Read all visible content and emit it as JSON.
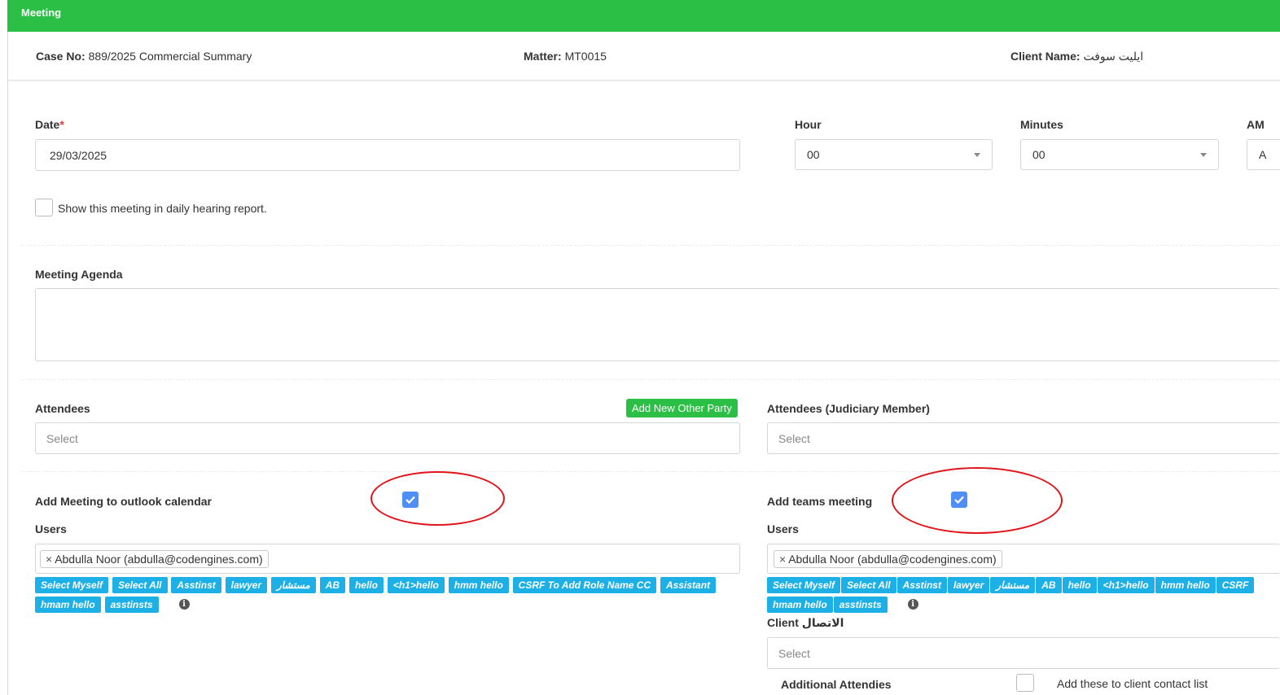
{
  "header": {
    "title": "Meeting"
  },
  "info": {
    "case_label": "Case No:",
    "case_value": "889/2025 Commercial Summary",
    "matter_label": "Matter:",
    "matter_value": "MT0015",
    "client_label": "Client Name:",
    "client_value": "ايليت سوفت"
  },
  "form": {
    "date_label": "Date",
    "date_required": "*",
    "date_value": "29/03/2025",
    "hour_label": "Hour",
    "hour_value": "00",
    "minutes_label": "Minutes",
    "minutes_value": "00",
    "ampm_label": "AM",
    "ampm_value": "A",
    "show_daily_label": "Show this meeting in daily hearing report.",
    "agenda_label": "Meeting Agenda",
    "attendees_label": "Attendees",
    "add_party_label": "Add New Other Party",
    "attendees_placeholder": "Select",
    "judiciary_label": "Attendees (Judiciary Member)",
    "judiciary_placeholder": "Select",
    "outlook_label": "Add Meeting to outlook calendar",
    "teams_label": "Add teams meeting",
    "users_label_left": "Users",
    "users_label_right": "Users",
    "user_chip_left": "Abdulla Noor (abdulla@codengines.com)",
    "user_chip_right": "Abdulla Noor (abdulla@codengines.com)",
    "client_contact_label": "Client الاتصال",
    "client_contact_placeholder": "Select",
    "additional_label": "Additional Attendies",
    "add_contact_label": "Add these to client contact list"
  },
  "tags_left": [
    "Select Myself",
    "Select All",
    "Asstinst",
    "lawyer",
    "مستشار",
    "AB",
    "hello",
    "<h1>hello",
    "hmm hello",
    "CSRF To Add Role Name CC",
    "Assistant",
    "hmam hello",
    "asstinsts"
  ],
  "tags_right": [
    "Select Myself",
    "Select All",
    "Asstinst",
    "lawyer",
    "مستشار",
    "AB",
    "hello",
    "<h1>hello",
    "hmm hello",
    "CSRF",
    "hmam hello",
    "asstinsts"
  ],
  "colors": {
    "brand_green": "#2cbf46",
    "tag_blue": "#1cb0e6",
    "check_blue": "#4f8ef5",
    "annotation_red": "#e0141b"
  }
}
